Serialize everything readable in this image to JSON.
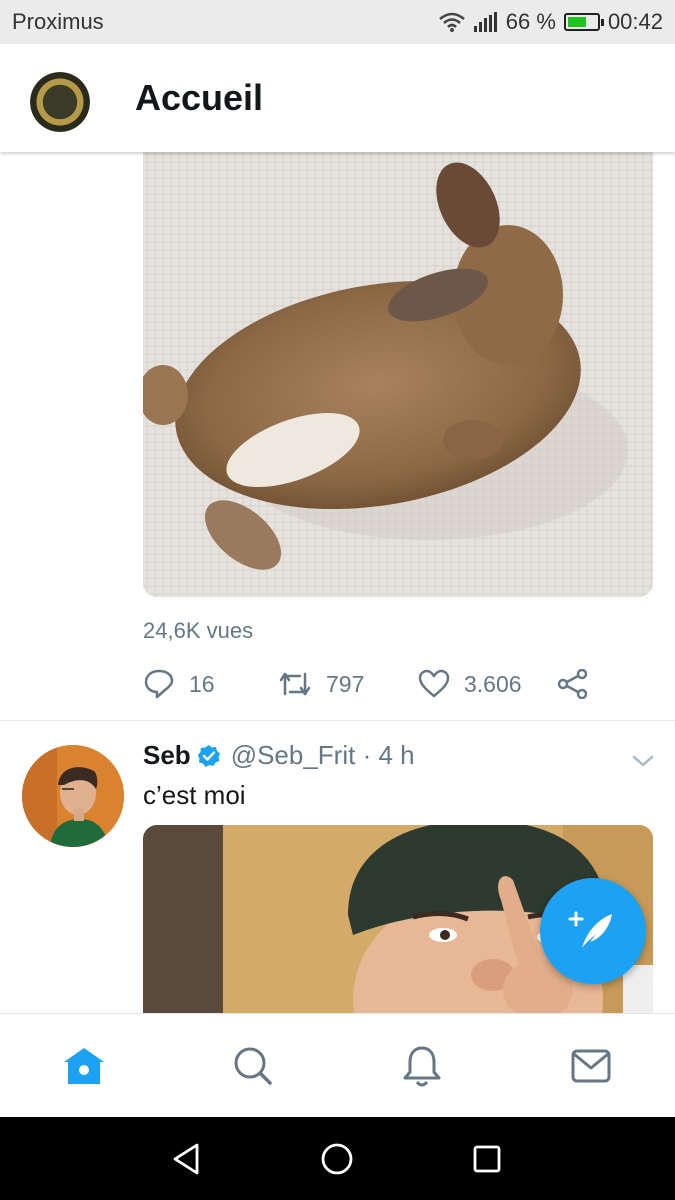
{
  "status_bar": {
    "carrier": "Proximus",
    "battery_percent": "66 %",
    "battery_level": 0.66,
    "time": "00:42"
  },
  "header": {
    "title": "Accueil"
  },
  "feed": {
    "tweet1": {
      "views": "24,6K vues",
      "replies": "16",
      "retweets": "797",
      "likes": "3.606"
    },
    "tweet2": {
      "author_name": "Seb",
      "handle_time": "@Seb_Frit · 4 h",
      "text": "c’est moi"
    }
  },
  "colors": {
    "accent": "#1da1f2",
    "muted": "#657786",
    "text": "#14171a"
  },
  "icons": {
    "fab": "compose-tweet-icon",
    "tabs": [
      "home-icon",
      "search-icon",
      "notifications-bell-icon",
      "messages-envelope-icon"
    ],
    "android_nav": [
      "back-icon",
      "home-circle-icon",
      "recents-square-icon"
    ]
  }
}
